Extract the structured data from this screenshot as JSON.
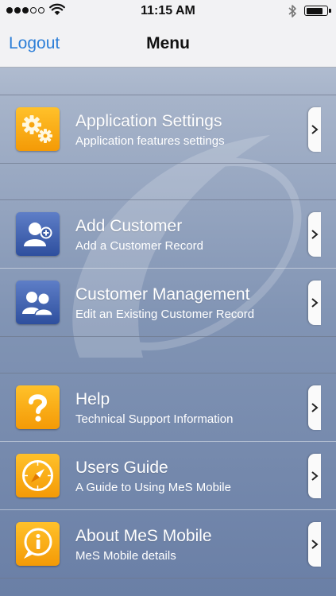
{
  "status_bar": {
    "time": "11:15 AM",
    "signal_bars_filled": 3,
    "signal_bars_total": 5,
    "battery_level": 0.85
  },
  "nav": {
    "left_button": "Logout",
    "title": "Menu"
  },
  "sections": [
    {
      "items": [
        {
          "title": "Application Settings",
          "subtitle": "Application features settings",
          "icon": "gears-icon"
        }
      ]
    },
    {
      "items": [
        {
          "title": "Add Customer",
          "subtitle": "Add a Customer Record",
          "icon": "add-user-icon"
        },
        {
          "title": "Customer Management",
          "subtitle": "Edit an Existing Customer Record",
          "icon": "users-icon"
        }
      ]
    },
    {
      "items": [
        {
          "title": "Help",
          "subtitle": "Technical Support Information",
          "icon": "question-icon"
        },
        {
          "title": "Users Guide",
          "subtitle": "A Guide to Using MeS Mobile",
          "icon": "compass-icon"
        },
        {
          "title": "About MeS Mobile",
          "subtitle": "MeS Mobile details",
          "icon": "info-bubble-icon"
        }
      ]
    }
  ],
  "colors": {
    "accent_blue": "#2d7fd8",
    "icon_orange": "#f8a81a",
    "icon_blue": "#3d5ea8"
  }
}
